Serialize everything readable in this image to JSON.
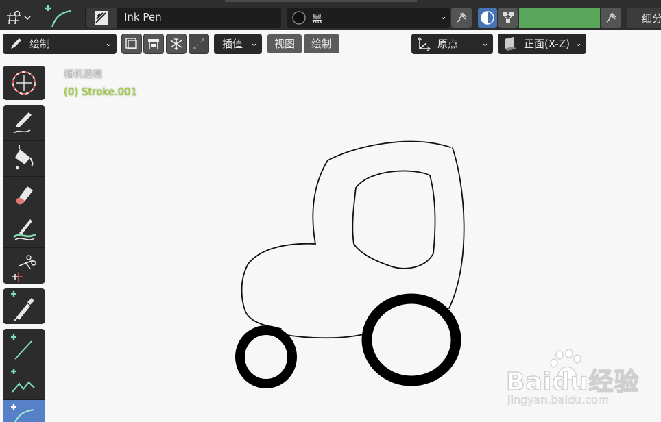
{
  "header": {
    "brush_name": "Ink Pen",
    "material_name": "黑",
    "right_label": "细分"
  },
  "toolbar": {
    "mode_label": "绘制",
    "interpolate_label": "插值",
    "view_label": "视图",
    "draw_label": "绘制",
    "origin_label": "原点",
    "plane_label": "正面(X-Z)"
  },
  "viewport": {
    "view_name": "相机透视",
    "object_name": "(0) Stroke.001"
  },
  "watermark": {
    "brand": "Baidu经验",
    "url": "jingyan.baidu.com"
  },
  "colors": {
    "accent_green": "#5aa65a",
    "active_tool": "#5681c9",
    "overlay_green": "#9ec93c"
  },
  "icons": [
    "placement-icon",
    "curve-tool-icon",
    "brush-icon",
    "material-sphere-icon",
    "pin-icon",
    "overlay-toggle-icon",
    "vertex-color-icon",
    "pencil-icon",
    "cursor-icon",
    "draw-icon",
    "fill-icon",
    "erase-icon",
    "tint-icon",
    "cutter-icon",
    "eyedropper-icon",
    "line-icon",
    "polyline-icon",
    "arc-icon"
  ]
}
